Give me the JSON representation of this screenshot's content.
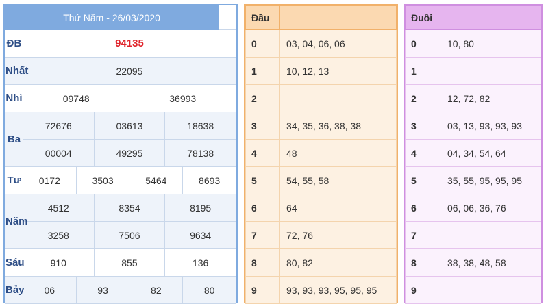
{
  "main": {
    "title": "Thứ Năm - 26/03/2020",
    "rows": {
      "db": {
        "label": "ĐB",
        "values": [
          "94135"
        ]
      },
      "nhat": {
        "label": "Nhất",
        "values": [
          "22095"
        ]
      },
      "nhi": {
        "label": "Nhì",
        "values": [
          "09748",
          "36993"
        ]
      },
      "ba": {
        "label": "Ba",
        "values": [
          "72676",
          "03613",
          "18638",
          "00004",
          "49295",
          "78138"
        ]
      },
      "tu": {
        "label": "Tư",
        "values": [
          "0172",
          "3503",
          "5464",
          "8693"
        ]
      },
      "nam": {
        "label": "Năm",
        "values": [
          "4512",
          "8354",
          "8195",
          "3258",
          "7506",
          "9634"
        ]
      },
      "sau": {
        "label": "Sáu",
        "values": [
          "910",
          "855",
          "136"
        ]
      },
      "bay": {
        "label": "Bảy",
        "values": [
          "06",
          "93",
          "82",
          "80"
        ]
      }
    }
  },
  "dau": {
    "header": "Đầu",
    "keys": [
      "0",
      "1",
      "2",
      "3",
      "4",
      "5",
      "6",
      "7",
      "8",
      "9"
    ],
    "values": [
      "03, 04, 06, 06",
      "10, 12, 13",
      "",
      "34, 35, 36, 38, 38",
      "48",
      "54, 55, 58",
      "64",
      "72, 76",
      "80, 82",
      "93, 93, 93, 95, 95, 95"
    ]
  },
  "duoi": {
    "header": "Đuôi",
    "keys": [
      "0",
      "1",
      "2",
      "3",
      "4",
      "5",
      "6",
      "7",
      "8",
      "9"
    ],
    "values": [
      "10, 80",
      "",
      "12, 72, 82",
      "03, 13, 93, 93, 93",
      "04, 34, 54, 64",
      "35, 55, 95, 95, 95",
      "06, 06, 36, 76",
      "",
      "38, 38, 48, 58",
      ""
    ]
  },
  "colors": {
    "main_header": "#7faadf",
    "special_prize": "#e0242b",
    "dau_header": "#fbd9b1",
    "duoi_header": "#e6b5ef"
  }
}
